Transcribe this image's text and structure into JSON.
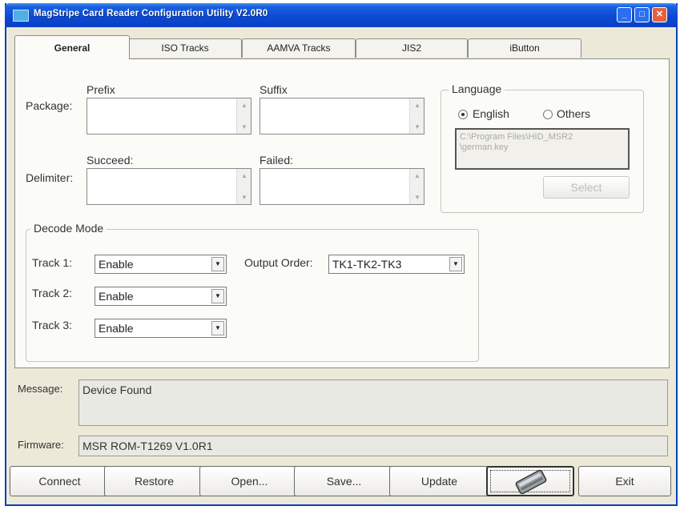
{
  "window": {
    "title": "MagStripe Card Reader Configuration Utility V2.0R0"
  },
  "tabs": [
    "General",
    "ISO Tracks",
    "AAMVA Tracks",
    "JIS2",
    "iButton"
  ],
  "general": {
    "package_label": "Package:",
    "delimiter_label": "Delimiter:",
    "prefix_label": "Prefix",
    "suffix_label": "Suffix",
    "succeed_label": "Succeed:",
    "failed_label": "Failed:",
    "prefix_value": "",
    "suffix_value": "",
    "succeed_value": "",
    "failed_value": ""
  },
  "language": {
    "title": "Language",
    "option_english": "English",
    "option_others": "Others",
    "selected": "English",
    "path_line1": "C:\\Program Files\\HID_MSR2",
    "path_line2": "\\german.key",
    "select_label": "Select"
  },
  "decode": {
    "title": "Decode Mode",
    "track1_label": "Track 1:",
    "track2_label": "Track 2:",
    "track3_label": "Track 3:",
    "track1_value": "Enable",
    "track2_value": "Enable",
    "track3_value": "Enable",
    "order_label": "Output Order:",
    "order_value": "TK1-TK2-TK3"
  },
  "status": {
    "message_label": "Message:",
    "message_value": "Device Found",
    "firmware_label": "Firmware:",
    "firmware_value": "MSR ROM-T1269 V1.0R1"
  },
  "buttons": {
    "connect": "Connect",
    "restore": "Restore",
    "open": "Open...",
    "save": "Save...",
    "update": "Update",
    "exit": "Exit"
  }
}
